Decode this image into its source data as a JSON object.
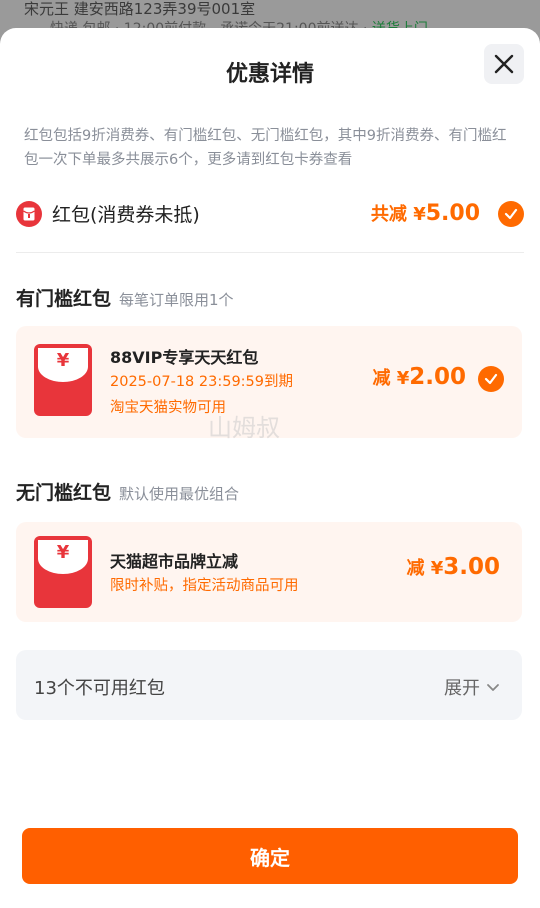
{
  "background": {
    "line1": "宋元王 建安西路123弄39号001室",
    "line2_prefix": "快递 包邮 · 12:00前付款，承诺今天21:00前送达 · ",
    "line2_highlight": "送货上门"
  },
  "sheet": {
    "title": "优惠详情",
    "close_icon": "close-icon",
    "description": "红包包括9折消费券、有门槛红包、无门槛红包，其中9折消费券、有门槛红包一次下单最多共展示6个，更多请到红包卡券查看"
  },
  "summary": {
    "label": "红包(消费券未抵)",
    "total_prefix": "共减 ¥",
    "total_amount": "5.00",
    "checked": true
  },
  "threshold_section": {
    "title": "有门槛红包",
    "subtitle": "每笔订单限用1个",
    "items": [
      {
        "yen": "¥",
        "name": "88VIP专享天天红包",
        "expiry": "2025-07-18 23:59:59到期",
        "scope": "淘宝天猫实物可用",
        "amount_prefix": "减 ¥",
        "amount": "2.00",
        "checked": true
      }
    ]
  },
  "no_threshold_section": {
    "title": "无门槛红包",
    "subtitle": "默认使用最优组合",
    "items": [
      {
        "yen": "¥",
        "name": "天猫超市品牌立减",
        "desc": "限时补贴，指定活动商品可用",
        "amount_prefix": "减 ¥",
        "amount": "3.00"
      }
    ]
  },
  "unavailable": {
    "label": "13个不可用红包",
    "expand_label": "展开"
  },
  "confirm_button": "确定",
  "watermark": "山姆叔",
  "colors": {
    "accent": "#ff6a00",
    "button": "#ff5f00",
    "red": "#e8353b",
    "card_bg": "#fff5f0"
  }
}
